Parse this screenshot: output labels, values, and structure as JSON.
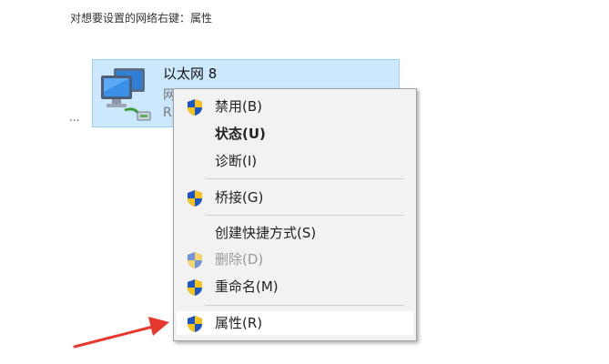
{
  "instruction": "对想要设置的网络右键：属性",
  "ellipsis": "...",
  "adapter": {
    "name": "以太网 8",
    "line1": "网",
    "line2": "R"
  },
  "menu": {
    "disable": "禁用(B)",
    "status": "状态(U)",
    "diagnose": "诊断(I)",
    "bridge": "桥接(G)",
    "shortcut": "创建快捷方式(S)",
    "delete": "删除(D)",
    "rename": "重命名(M)",
    "properties": "属性(R)"
  },
  "colors": {
    "selection": "#cce8ff",
    "arrow": "#e8372c",
    "shield_blue": "#1a56c4",
    "shield_yellow": "#f7c21a"
  },
  "icons": {
    "adapter": "network-adapter-icon",
    "shield": "uac-shield-icon"
  }
}
